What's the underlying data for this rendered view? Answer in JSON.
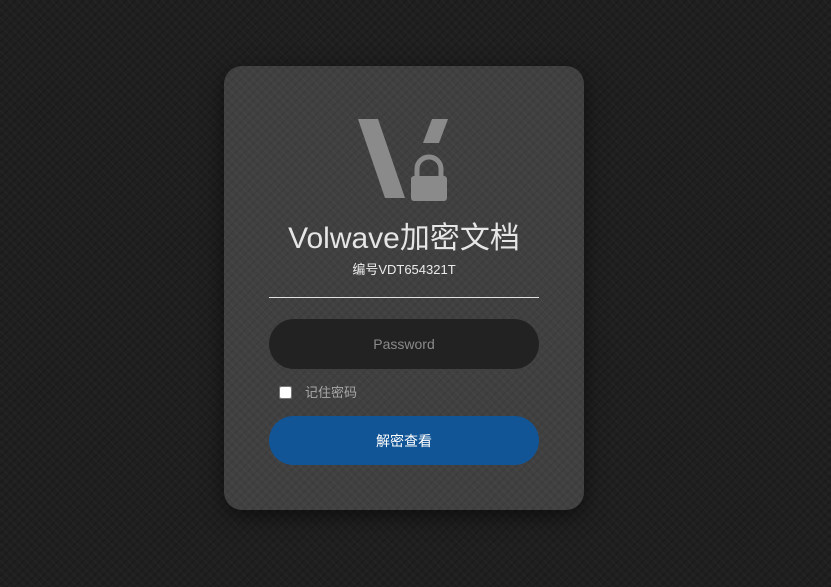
{
  "login": {
    "logo_icon": "volwave-lock-logo-icon",
    "title": "Volwave加密文档",
    "doc_number": "编号VDT654321T",
    "password_placeholder": "Password",
    "password_value": "",
    "remember_checked": false,
    "remember_label": "记住密码",
    "submit_label": "解密查看"
  },
  "colors": {
    "background": "#1f1f1f",
    "card": "#404040",
    "logo": "#8a8a8a",
    "input_bg": "#222222",
    "button": "#125596"
  }
}
